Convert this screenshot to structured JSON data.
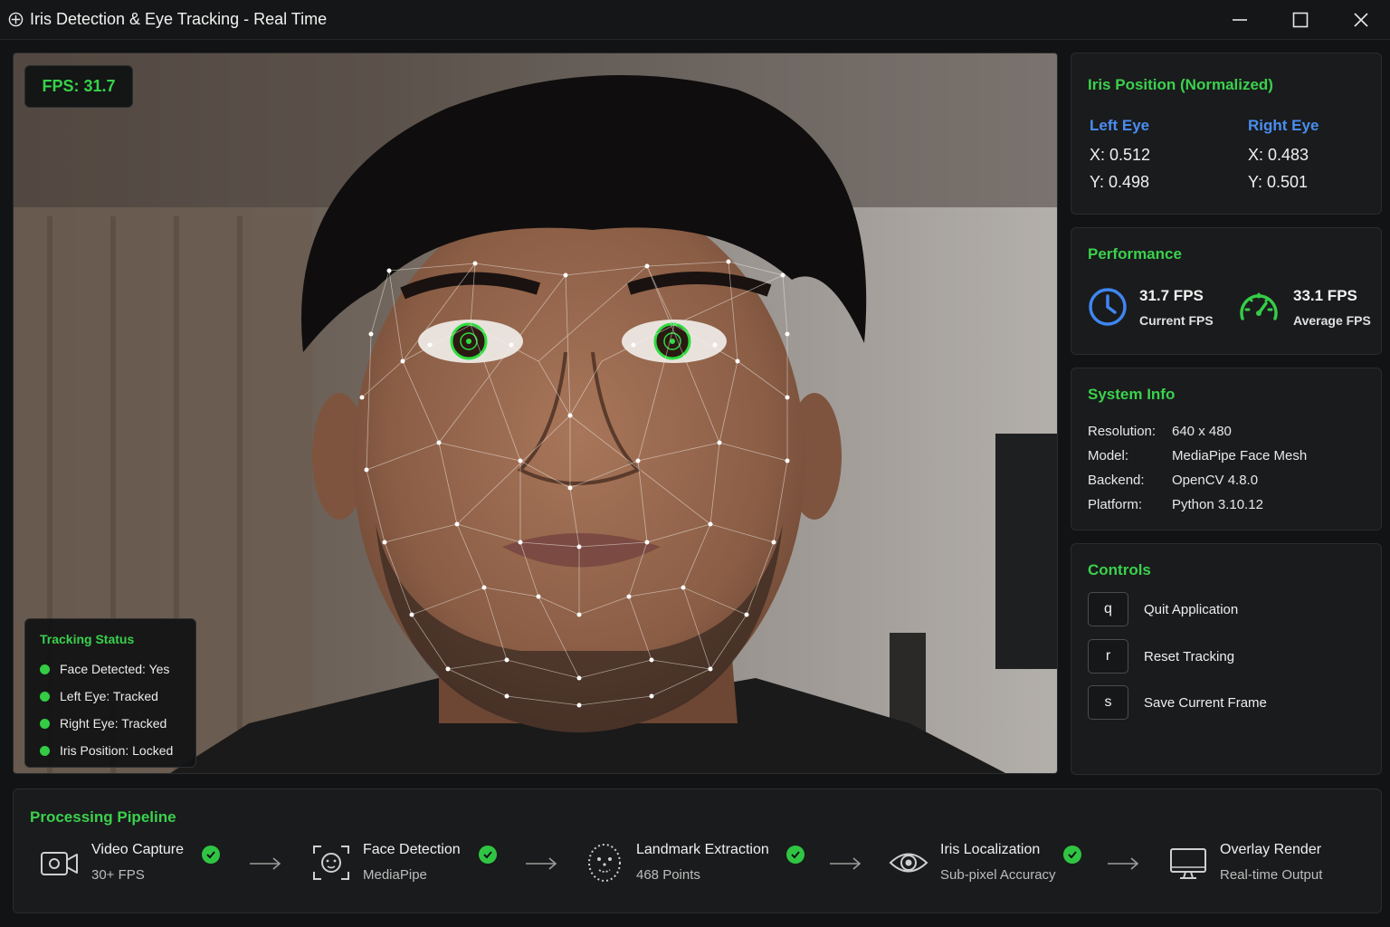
{
  "window": {
    "title": "Iris Detection & Eye Tracking - Real Time"
  },
  "video": {
    "fps_badge": "FPS: 31.7",
    "tracking_status": {
      "heading": "Tracking Status",
      "items": [
        "Face Detected: Yes",
        "Left Eye: Tracked",
        "Right Eye: Tracked",
        "Iris Position: Locked"
      ]
    }
  },
  "iris_panel": {
    "title": "Iris Position (Normalized)",
    "left_eye": {
      "label": "Left Eye",
      "x": "X:  0.512",
      "y": "Y:  0.498"
    },
    "right_eye": {
      "label": "Right Eye",
      "x": "X:  0.483",
      "y": "Y:  0.501"
    }
  },
  "performance": {
    "title": "Performance",
    "current": {
      "value": "31.7 FPS",
      "label": "Current FPS",
      "icon": "clock-icon"
    },
    "average": {
      "value": "33.1 FPS",
      "label": "Average FPS",
      "icon": "speedometer-icon"
    }
  },
  "system_info": {
    "title": "System Info",
    "rows": [
      {
        "key": "Resolution:",
        "value": "640 x 480"
      },
      {
        "key": "Model:",
        "value": "MediaPipe Face Mesh"
      },
      {
        "key": "Backend:",
        "value": "OpenCV 4.8.0"
      },
      {
        "key": "Platform:",
        "value": "Python 3.10.12"
      }
    ]
  },
  "controls": {
    "title": "Controls",
    "items": [
      {
        "key": "q",
        "label": "Quit Application"
      },
      {
        "key": "r",
        "label": "Reset Tracking"
      },
      {
        "key": "s",
        "label": "Save Current Frame"
      }
    ]
  },
  "pipeline": {
    "title": "Processing Pipeline",
    "stages": [
      {
        "title": "Video Capture",
        "subtitle": "30+ FPS",
        "icon": "camera-icon",
        "done": true
      },
      {
        "title": "Face Detection",
        "subtitle": "MediaPipe",
        "icon": "face-scan-icon",
        "done": true
      },
      {
        "title": "Landmark Extraction",
        "subtitle": "468 Points",
        "icon": "face-dots-icon",
        "done": true
      },
      {
        "title": "Iris Localization",
        "subtitle": "Sub-pixel Accuracy",
        "icon": "eye-icon",
        "done": true
      },
      {
        "title": "Overlay Render",
        "subtitle": "Real-time Output",
        "icon": "monitor-icon",
        "done": false
      }
    ]
  },
  "colors": {
    "accent_green": "#3bd14d",
    "accent_blue": "#4a8df0",
    "background": "#121314",
    "panel": "#1a1b1c"
  }
}
